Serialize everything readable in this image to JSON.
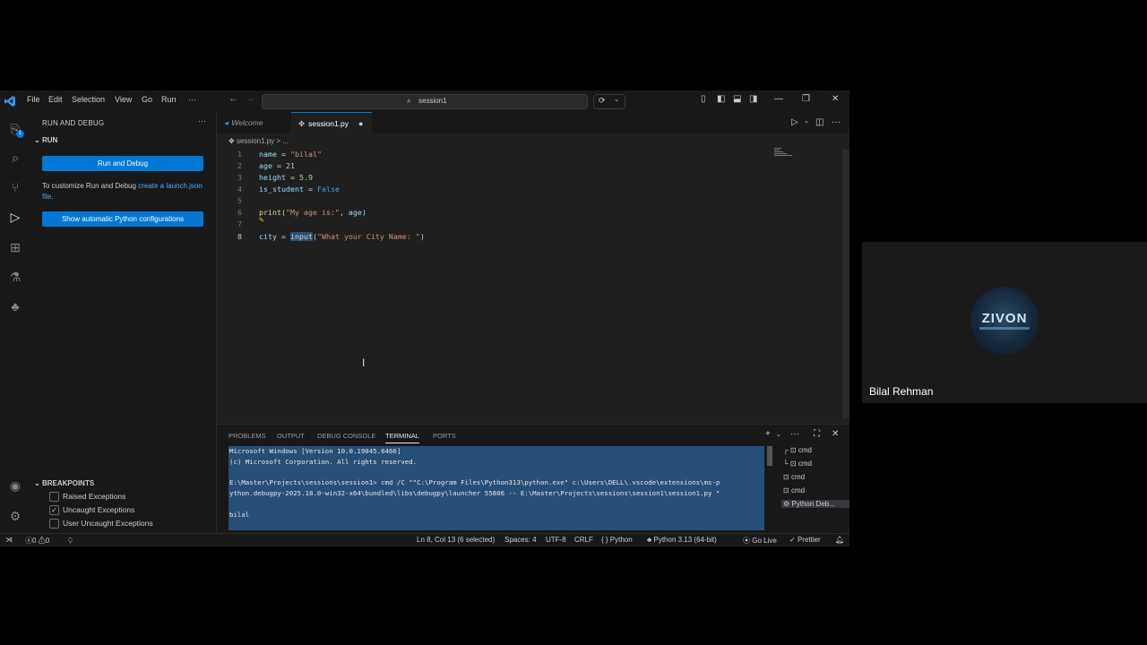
{
  "menu": [
    "File",
    "Edit",
    "Selection",
    "View",
    "Go",
    "Run"
  ],
  "search": {
    "text": "session1"
  },
  "activity_badge": "1",
  "sidebar": {
    "title": "RUN AND DEBUG",
    "section": "RUN",
    "run_button": "Run and Debug",
    "customize_text": "To customize Run and Debug",
    "customize_link": "create a launch.json file",
    "customize_end": ".",
    "python_button": "Show automatic Python configurations",
    "breakpoints_title": "BREAKPOINTS",
    "breakpoints": [
      {
        "label": "Raised Exceptions",
        "checked": false
      },
      {
        "label": "Uncaught Exceptions",
        "checked": true
      },
      {
        "label": "User Uncaught Exceptions",
        "checked": false
      }
    ]
  },
  "tabs": [
    {
      "label": "Welcome"
    },
    {
      "label": "session1.py",
      "modified": true
    }
  ],
  "breadcrumb": "session1.py > ...",
  "code": {
    "line_numbers": [
      "1",
      "2",
      "3",
      "4",
      "5",
      "6",
      "7",
      "8"
    ],
    "line1": {
      "var": "name",
      "op": " = ",
      "str": "\"bilal\""
    },
    "line2": {
      "var": "age",
      "op": " = ",
      "num": "21"
    },
    "line3": {
      "var": "height",
      "op": " = ",
      "num": "5.9"
    },
    "line4": {
      "var": "is_student",
      "op": " = ",
      "kw": "False"
    },
    "line6": {
      "fn": "print",
      "open": "(",
      "str": "\"My age is:\"",
      "rest": ", age)"
    },
    "line8": {
      "var": "city",
      "op": " = ",
      "fn": "input",
      "open": "(",
      "str": "\"What your City Name: \"",
      "close": ")"
    }
  },
  "panel": {
    "tabs": [
      "PROBLEMS",
      "OUTPUT",
      "DEBUG CONSOLE",
      "TERMINAL",
      "PORTS"
    ],
    "active_tab": "TERMINAL",
    "terminal_lines": [
      "Microsoft Windows [Version 10.0.19045.6466]",
      "(c) Microsoft Corporation. All rights reserved.",
      "",
      "E:\\Master\\Projects\\sessions\\session1> cmd /C \"\"C:\\Program Files\\Python313\\python.exe\" c:\\Users\\DELL\\.vscode\\extensions\\ms-p",
      "ython.debugpy-2025.18.0-win32-x64\\bundled\\libs\\debugpy\\launcher 55806 -- E:\\Master\\Projects\\sessions\\session1\\session1.py \"",
      "",
      "bilal"
    ],
    "terminals": [
      "cmd",
      "cmd",
      "cmd",
      "cmd",
      "Python Deb..."
    ]
  },
  "status": {
    "problems": "0",
    "warnings": "0",
    "position": "Ln 8, Col 13 (6 selected)",
    "spaces": "Spaces: 4",
    "encoding": "UTF-8",
    "eol": "CRLF",
    "language": "Python",
    "interpreter": "Python 3.13 (64-bit)",
    "golive": "Go Live",
    "prettier": "Prettier"
  },
  "participant": {
    "name": "Bilal Rehman",
    "logo_text": "ZIVON"
  }
}
